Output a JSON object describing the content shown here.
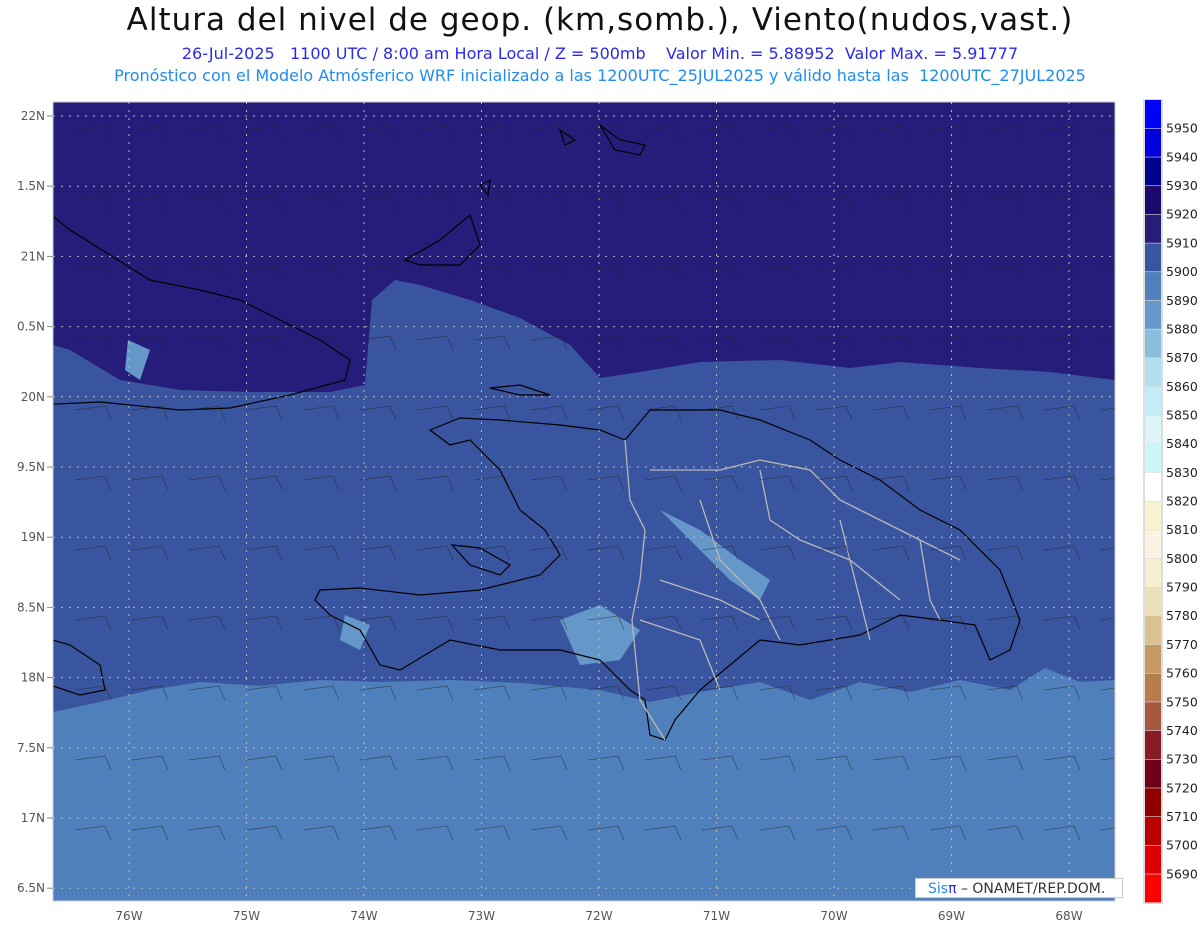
{
  "header": {
    "title": "Altura del nivel de geop. (km,somb.), Viento(nudos,vast.)",
    "subtitle": "26-Jul-2025   1100 UTC / 8:00 am Hora Local / Z = 500mb    Valor Min. = 5.88952  Valor Max. = 5.91777",
    "model_info": "Pronóstico con el Modelo Atmósferico WRF inicializado a las 1200UTC_25JUL2025 y válido hasta las  1200UTC_27JUL2025"
  },
  "axes": {
    "lat_labels": [
      "22N",
      "1.5N",
      "21N",
      "0.5N",
      "20N",
      "9.5N",
      "19N",
      "8.5N",
      "18N",
      "7.5N",
      "17N",
      "6.5N"
    ],
    "lon_labels": [
      "76W",
      "75W",
      "74W",
      "73W",
      "72W",
      "71W",
      "70W",
      "69W",
      "68W"
    ]
  },
  "colorbar": {
    "labels": [
      "5950",
      "5940",
      "5930",
      "5920",
      "5910",
      "5900",
      "5890",
      "5880",
      "5870",
      "5860",
      "5850",
      "5840",
      "5830",
      "5820",
      "5810",
      "5800",
      "5790",
      "5780",
      "5770",
      "5760",
      "5750",
      "5740",
      "5730",
      "5720",
      "5710",
      "5700",
      "5690"
    ],
    "colors": [
      "#0000ff",
      "#0000dd",
      "#00008f",
      "#1b0a6b",
      "#261d7b",
      "#3a559f",
      "#4f80bb",
      "#6598c8",
      "#8bbedd",
      "#b2dfee",
      "#c4ecf4",
      "#def4f8",
      "#cbf7fb",
      "#ffffff",
      "#f8f2d0",
      "#faf5e3",
      "#f6efd1",
      "#eee0b8",
      "#dbc18e",
      "#c69964",
      "#b57d4e",
      "#a4583f",
      "#861a27",
      "#6e0019",
      "#900000",
      "#bb0000",
      "#dd0000",
      "#ff0000"
    ]
  },
  "fill_colors": {
    "dark": "#261d7b",
    "mid": "#3a559f",
    "light": "#4f80bb",
    "patch": "#6598c8"
  },
  "credit": {
    "sis": "Sis",
    "pi": "π",
    "rest": " – ONAMET/REP.DOM."
  }
}
